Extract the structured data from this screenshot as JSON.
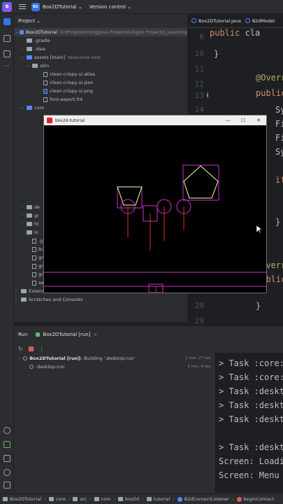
{
  "titlebar": {
    "project_badge": "B2",
    "project": "Box2DTutorial ⌄",
    "vcs": "Version control ⌄"
  },
  "project_panel": {
    "title": "Project ⌄",
    "tree": [
      {
        "label": "Box2DTutorial",
        "note": "D:\\Programming\\Java Projects\\Libgdx Projects\\_Learning",
        "arrow": "⌄"
      },
      {
        "label": ".gradle",
        "arrow": "›"
      },
      {
        "label": ".idea",
        "arrow": "›"
      },
      {
        "label": "assets [main]",
        "note": "resources root",
        "arrow": "⌄"
      },
      {
        "label": "skin",
        "arrow": "⌄"
      },
      {
        "label": "clean-crispy-ui.atlas"
      },
      {
        "label": "clean-crispy-ui.json"
      },
      {
        "label": "clean-crispy-ui.png"
      },
      {
        "label": "font-export.fnt"
      },
      {
        "label": "core",
        "arrow": "⌄"
      },
      {
        "label": "de",
        "arrow": "›"
      },
      {
        "label": "gr",
        "arrow": "›"
      },
      {
        "label": "ht",
        "arrow": "›"
      },
      {
        "label": "lo",
        "arrow": "›"
      },
      {
        "label": ".g"
      },
      {
        "label": "bu"
      },
      {
        "label": "gr"
      },
      {
        "label": "gr"
      },
      {
        "label": "gr"
      },
      {
        "label": "se"
      },
      {
        "label": "External Libraries",
        "arrow": "›"
      },
      {
        "label": "Scratches and Consoles",
        "arrow": "›"
      }
    ]
  },
  "editor": {
    "tabs": [
      {
        "label": "Box2DTutorial.java"
      },
      {
        "label": "B2dModel"
      }
    ],
    "line_numbers": [
      "6",
      "10",
      "11",
      "12",
      "13",
      "14",
      "",
      "",
      "",
      "",
      "",
      "",
      "",
      "",
      "",
      "27",
      "28",
      "29"
    ],
    "code_lines": [
      {
        "kw": "public",
        "rest": " cla"
      },
      {
        "plain": "}"
      },
      {
        "ann": "@Overr"
      },
      {
        "kw": "public"
      },
      {
        "plain": "Sy"
      },
      {
        "plain": "Fi"
      },
      {
        "plain": "Fi"
      },
      {
        "plain": "Sy"
      },
      {
        "kw": "if"
      },
      {
        "plain": "}"
      },
      {
        "ann": "@Overr"
      },
      {
        "kw": "public"
      },
      {
        "plain": "}"
      }
    ]
  },
  "game_window": {
    "title": "box2d-tutorial",
    "controls": {
      "minimize": "—",
      "maximize": "☐",
      "close": "✕"
    },
    "shape_color": "#c832c8",
    "highlight_color": "#ffffaa",
    "joint_color": "#e03030"
  },
  "run_panel": {
    "title": "Run",
    "tab": "Box2DTutorial [run]",
    "close": "×",
    "tools": {
      "restart": "↻",
      "more": "⋮"
    },
    "build_rows": [
      {
        "label": "Box2DTutorial [run]:",
        "detail": "Building ':desktop:run'",
        "time": "1 min, 27 sec"
      },
      {
        "label": ":desktop:run",
        "detail": "",
        "time": "1 min, 8 sec"
      }
    ],
    "console_lines": [
      "> Task :core:",
      "> Task :core:",
      "> Task :deskt",
      "> Task :deskt",
      "> Task :deskt",
      "",
      "> Task :deskt",
      "Screen: Loadi",
      "Screen: Menu"
    ]
  },
  "statusbar": {
    "crumbs": [
      "Box2DTutorial",
      "core",
      "src",
      "com",
      "box2d",
      "tutorial",
      "B2dContactListener",
      "beginContact"
    ],
    "separator": "›"
  }
}
